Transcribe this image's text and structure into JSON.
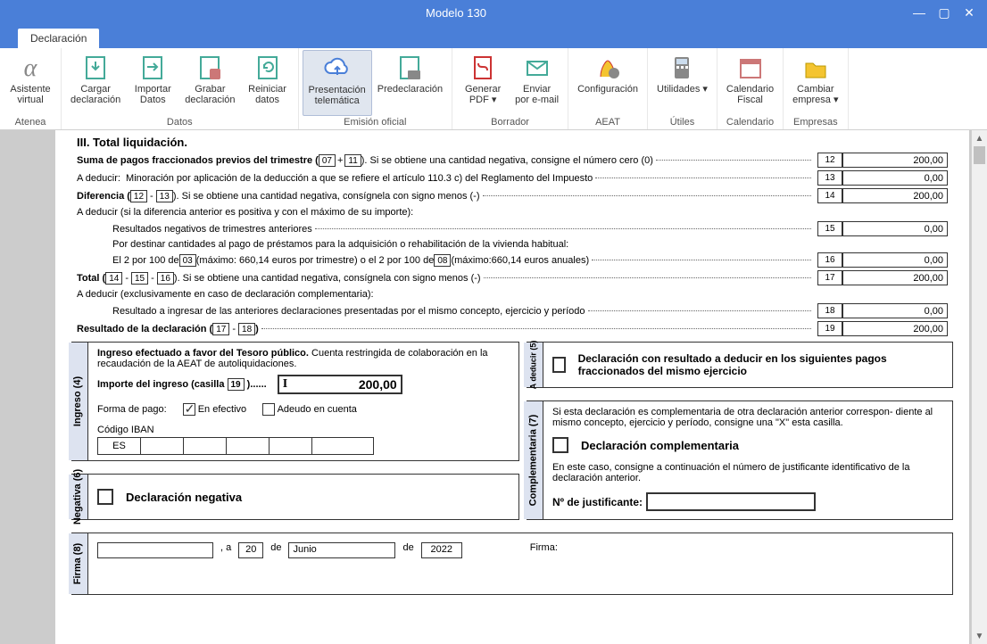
{
  "window": {
    "title": "Modelo 130"
  },
  "tab": {
    "main": "Declaración"
  },
  "ribbon": {
    "atenea": {
      "asistente_1": "Asistente",
      "asistente_2": "virtual",
      "group": "Atenea"
    },
    "datos": {
      "cargar_1": "Cargar",
      "cargar_2": "declaración",
      "importar_1": "Importar",
      "importar_2": "Datos",
      "grabar_1": "Grabar",
      "grabar_2": "declaración",
      "reiniciar_1": "Reiniciar",
      "reiniciar_2": "datos",
      "group": "Datos"
    },
    "emision": {
      "presentacion_1": "Presentación",
      "presentacion_2": "telemática",
      "predeclaracion": "Predeclaración",
      "group": "Emisión oficial"
    },
    "borrador": {
      "generar_1": "Generar",
      "generar_2": "PDF ▾",
      "enviar_1": "Enviar",
      "enviar_2": "por e-mail",
      "group": "Borrador"
    },
    "aeat": {
      "config": "Configuración",
      "group": "AEAT"
    },
    "utiles": {
      "util": "Utilidades ▾",
      "group": "Útiles"
    },
    "calendario": {
      "cal_1": "Calendario",
      "cal_2": "Fiscal",
      "group": "Calendario"
    },
    "empresas": {
      "cambiar_1": "Cambiar",
      "cambiar_2": "empresa ▾",
      "group": "Empresas"
    }
  },
  "form": {
    "h3": "III.  Total liquidación.",
    "line_suma": "Suma de pagos fraccionados previos del trimestre (",
    "box07": "07",
    "plus": "+",
    "box11": "11",
    "line_suma_end": " ). Si se obtiene una cantidad negativa, consigne el número cero (0)",
    "adeducir": "A deducir:",
    "adeducir_txt": "Minoración por aplicación de la deducción a que se refiere el artículo 110.3 c) del Reglamento del Impuesto",
    "diferencia": "Diferencia (",
    "box12": "12",
    "minus": "-",
    "box13": "13",
    "diferencia_end": " ). Si se obtiene una cantidad negativa, consígnela con signo menos (-)",
    "adeducir_si": "A deducir (si la diferencia anterior es positiva y con el máximo de su importe):",
    "resultados_neg": "Resultados negativos de trimestres anteriores",
    "por_destinar": "Por destinar cantidades al pago de préstamos para la adquisición o rehabilitación de la vivienda habitual:",
    "el2por100_a": "El 2 por 100 de ",
    "box03": "03",
    "el2por100_b": " (máximo: 660,14 euros por trimestre) o el 2 por 100 de ",
    "box08": "08",
    "el2por100_c": "   (máximo:660,14 euros anuales)",
    "total": "Total (",
    "box14": "14",
    "box15": "15",
    "box16": "16",
    "total_end": " ). Si se obtiene una cantidad negativa, consígnela con signo menos (-)",
    "adeducir_excl": "A deducir (exclusivamente en caso de declaración complementaria):",
    "resultado_ing": "Resultado a ingresar de las anteriores declaraciones presentadas por el mismo concepto, ejercicio y período",
    "resultado_decl": "Resultado de la declaración (",
    "box17": "17",
    "box18": "18",
    "resultado_decl_end": " )",
    "cells": {
      "n12": "12",
      "v12": "200,00",
      "n13": "13",
      "v13": "0,00",
      "n14": "14",
      "v14": "200,00",
      "n15": "15",
      "v15": "0,00",
      "n16": "16",
      "v16": "0,00",
      "n17": "17",
      "v17": "200,00",
      "n18": "18",
      "v18": "0,00",
      "n19": "19",
      "v19": "200,00"
    }
  },
  "ingreso": {
    "label": "Ingreso (4)",
    "intro_a": "Ingreso efectuado a favor del Tesoro público.",
    "intro_b": " Cuenta restringida de colaboración en la recaudación de la AEAT de autoliquidaciones.",
    "importe": "Importe del ingreso (casilla ",
    "box19": "19",
    "importe_end": " )......",
    "value": "200,00",
    "cursor_char": "I",
    "forma": "Forma de pago:",
    "efectivo": "En efectivo",
    "adeudo": "Adeudo en cuenta",
    "iban_label": "Código IBAN",
    "iban_prefix": "ES"
  },
  "adeducir_box": {
    "label": "A deducir (5)",
    "text": "Declaración con resultado a deducir en los siguientes pagos fraccionados del mismo ejercicio"
  },
  "negativa": {
    "label": "Negativa (6)",
    "text": "Declaración negativa"
  },
  "complementaria": {
    "label": "Complementaria (7)",
    "intro": "Si esta declaración es complementaria de otra declaración anterior correspon- diente al mismo concepto, ejercicio y período, consigne una \"X\" esta casilla.",
    "title": "Declaración complementaria",
    "note": "En este caso, consigne a continuación el número de justificante identificativo de la declaración anterior.",
    "num_just": "Nº de justificante:"
  },
  "firma": {
    "label": "Firma (8)",
    "a": ", a",
    "day": "20",
    "de1": "de",
    "month": "Junio",
    "de2": "de",
    "year": "2022",
    "firma": "Firma:"
  }
}
